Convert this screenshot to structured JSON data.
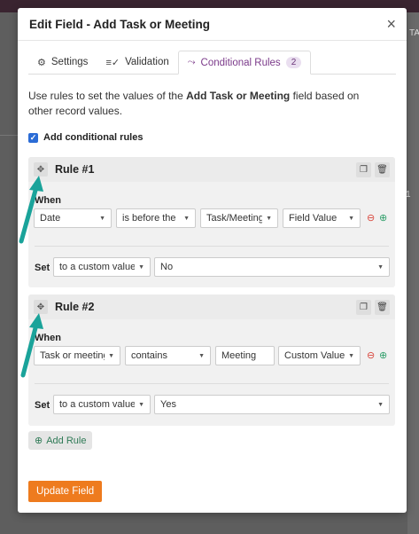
{
  "backdrop": {
    "right_text": "TA",
    "right_num": "1"
  },
  "modal": {
    "title": "Edit Field - Add Task or Meeting",
    "close_label": "×"
  },
  "tabs": [
    {
      "label": "Settings",
      "icon": "gear-icon"
    },
    {
      "label": "Validation",
      "icon": "validation-icon"
    },
    {
      "label": "Conditional Rules",
      "icon": "branch-icon",
      "badge": "2",
      "active": true
    }
  ],
  "description": {
    "prefix": "Use rules to set the values of the ",
    "field_name": "Add Task or Meeting",
    "suffix": " field based on other record values."
  },
  "add_conditional_rules": {
    "label": "Add conditional rules",
    "checked": true
  },
  "rules": [
    {
      "title": "Rule #1",
      "when_label": "When",
      "condition": {
        "field": "Date",
        "operator": "is before the",
        "target": "Task/Meeting",
        "value_type": "Field Value"
      },
      "set_label": "Set",
      "set_mode": "to a custom value",
      "set_value": "No"
    },
    {
      "title": "Rule #2",
      "when_label": "When",
      "condition": {
        "field": "Task or meeting",
        "operator": "contains",
        "target": "Meeting",
        "value_type": "Custom Value"
      },
      "set_label": "Set",
      "set_mode": "to a custom value",
      "set_value": "Yes"
    }
  ],
  "add_rule_label": "Add Rule",
  "update_button_label": "Update Field",
  "colors": {
    "accent_purple": "#7b3a8a",
    "update_orange": "#ee7b1e",
    "arrow_teal": "#1aa39a",
    "remove_red": "#d9453b",
    "add_green": "#2f9e6a"
  }
}
